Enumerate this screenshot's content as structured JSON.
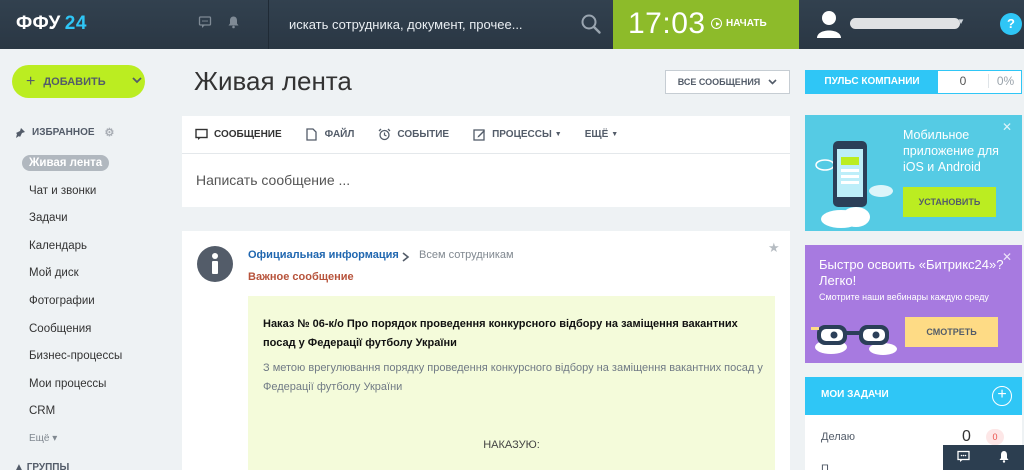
{
  "header": {
    "logo": "ФФУ",
    "logo_num": "24",
    "search_placeholder": "искать сотрудника, документ, прочее...",
    "time": "17:03",
    "start_label": "НАЧАТЬ",
    "help": "?"
  },
  "sidebar": {
    "add_label": "ДОБАВИТЬ",
    "favorites_title": "ИЗБРАННОЕ",
    "items": [
      {
        "label": "Живая лента"
      },
      {
        "label": "Чат и звонки"
      },
      {
        "label": "Задачи"
      },
      {
        "label": "Календарь"
      },
      {
        "label": "Мой диск"
      },
      {
        "label": "Фотографии"
      },
      {
        "label": "Сообщения"
      },
      {
        "label": "Бизнес-процессы"
      },
      {
        "label": "Мои процессы"
      },
      {
        "label": "CRM"
      }
    ],
    "more": "Ещё",
    "groups_title": "ГРУППЫ"
  },
  "main": {
    "title": "Живая лента",
    "filter_label": "ВСЕ СООБЩЕНИЯ",
    "composer": {
      "tabs": [
        {
          "label": "СООБЩЕНИЕ"
        },
        {
          "label": "ФАЙЛ"
        },
        {
          "label": "СОБЫТИЕ"
        },
        {
          "label": "ПРОЦЕССЫ"
        },
        {
          "label": "ЕЩЁ"
        }
      ],
      "placeholder": "Написать сообщение ..."
    },
    "post": {
      "author": "Официальная информация",
      "recipients": "Всем сотрудникам",
      "tag": "Важное сообщение",
      "body_title": "Наказ № 06-к/о Про порядок проведення конкурсного відбору на заміщення вакантних посад у Федерації футболу України",
      "body_text": "З метою врегулювання порядку проведення конкурсного відбору на заміщення вакантних посад у Федерації футболу України",
      "body_order": "НАКАЗУЮ:"
    }
  },
  "right": {
    "pulse_label": "ПУЛЬС КОМПАНИИ",
    "pulse_value": "0",
    "pulse_percent": "0%",
    "mobile_banner": {
      "text": "Мобильное приложение для iOS и Android",
      "button": "УСТАНОВИТЬ"
    },
    "learn_banner": {
      "title": "Быстро освоить «Битрикс24»? Легко!",
      "subtitle": "Смотрите наши вебинары каждую среду",
      "button": "СМОТРЕТЬ"
    },
    "tasks": {
      "title": "МОИ ЗАДАЧИ",
      "row_label": "Делаю",
      "row_count": "0",
      "row_badge": "0",
      "next_row": "П"
    }
  },
  "colors": {
    "topbar": "#2c3e50",
    "accent_blue": "#2fc6f6",
    "clock_green": "#8dbb2a",
    "add_green": "#bbed21",
    "post_bg": "#f4fbda",
    "banner_blue": "#55cbe4",
    "banner_purple": "#a77ae0"
  }
}
